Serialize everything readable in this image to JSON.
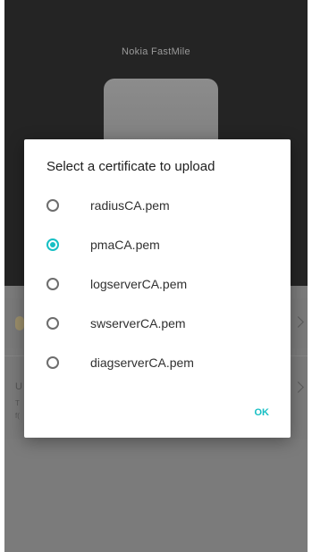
{
  "background": {
    "app_title": "Nokia FastMile",
    "card2_letter": "U",
    "card2_stub_line1": "T",
    "card2_stub_line2": "f("
  },
  "dialog": {
    "title": "Select a certificate to upload",
    "options": [
      {
        "label": "radiusCA.pem",
        "selected": false
      },
      {
        "label": "pmaCA.pem",
        "selected": true
      },
      {
        "label": "logserverCA.pem",
        "selected": false
      },
      {
        "label": "swserverCA.pem",
        "selected": false
      },
      {
        "label": "diagserverCA.pem",
        "selected": false
      }
    ],
    "ok_label": "OK"
  },
  "colors": {
    "accent": "#16bfc4",
    "top_panel": "#242424",
    "scrim": "#7b7b7b"
  }
}
